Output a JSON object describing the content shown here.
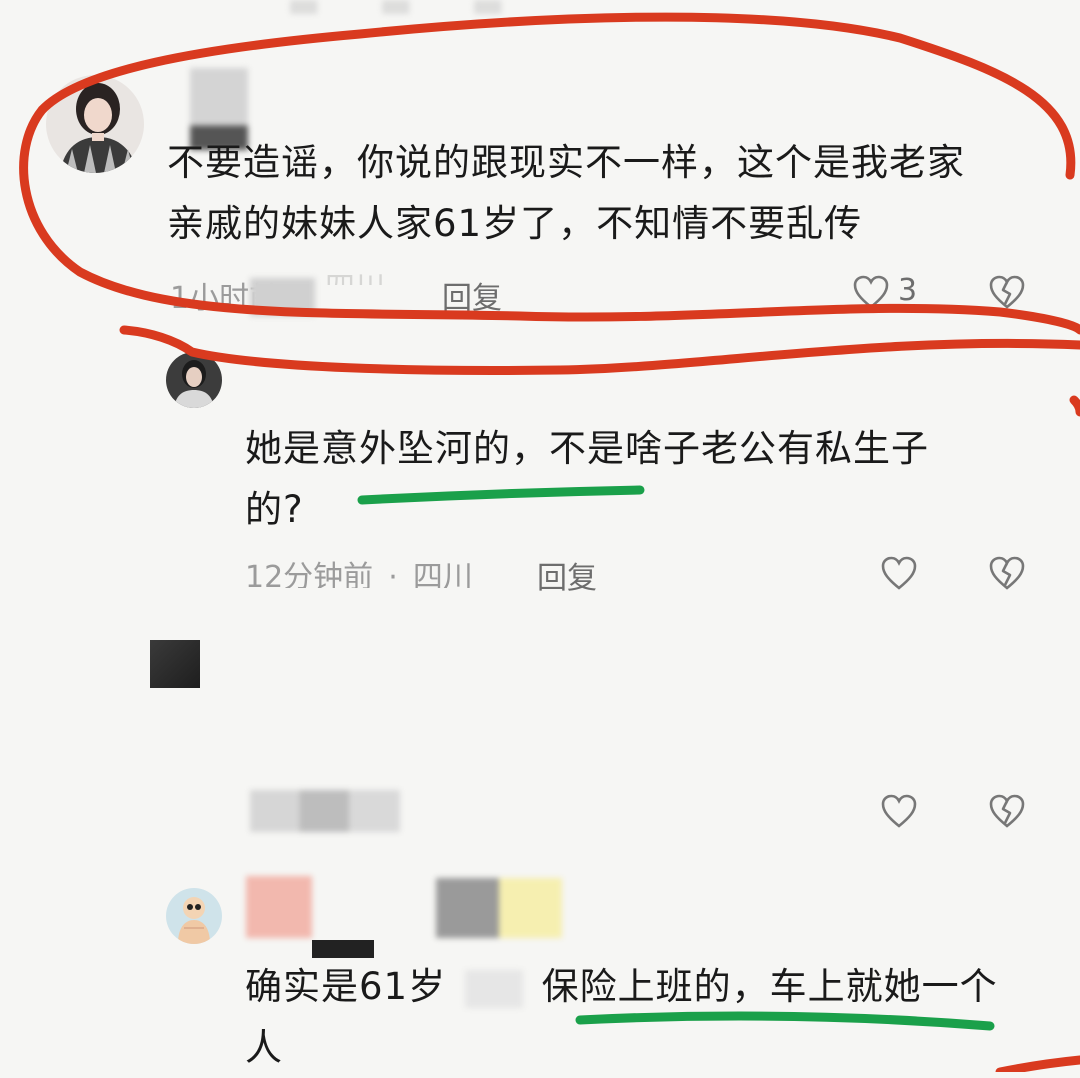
{
  "comments": [
    {
      "text_lines": [
        "不要造谣，你说的跟现实不一样，这个是我老家",
        "亲戚的妹妹人家61岁了，不知情不要乱传"
      ],
      "time": "1小时前",
      "location": "四川",
      "reply_label": "回复",
      "like_count": "3"
    },
    {
      "text_lines": [
        "她是意外坠河的，不是啥子老公有私生子",
        "的?"
      ],
      "time": "12分钟前",
      "separator": "·",
      "location": "四川",
      "reply_label": "回复"
    },
    {
      "text_lines": [
        "确实是61岁",
        "保险上班的，车上就她一个",
        "人"
      ]
    }
  ],
  "icons": {
    "like": "heart-outline-icon",
    "dislike": "broken-heart-icon"
  },
  "colors": {
    "background": "#f6f6f4",
    "red_annotation": "#d93a1f",
    "green_annotation": "#1aa04a",
    "meta_text": "#9b9b9b"
  }
}
